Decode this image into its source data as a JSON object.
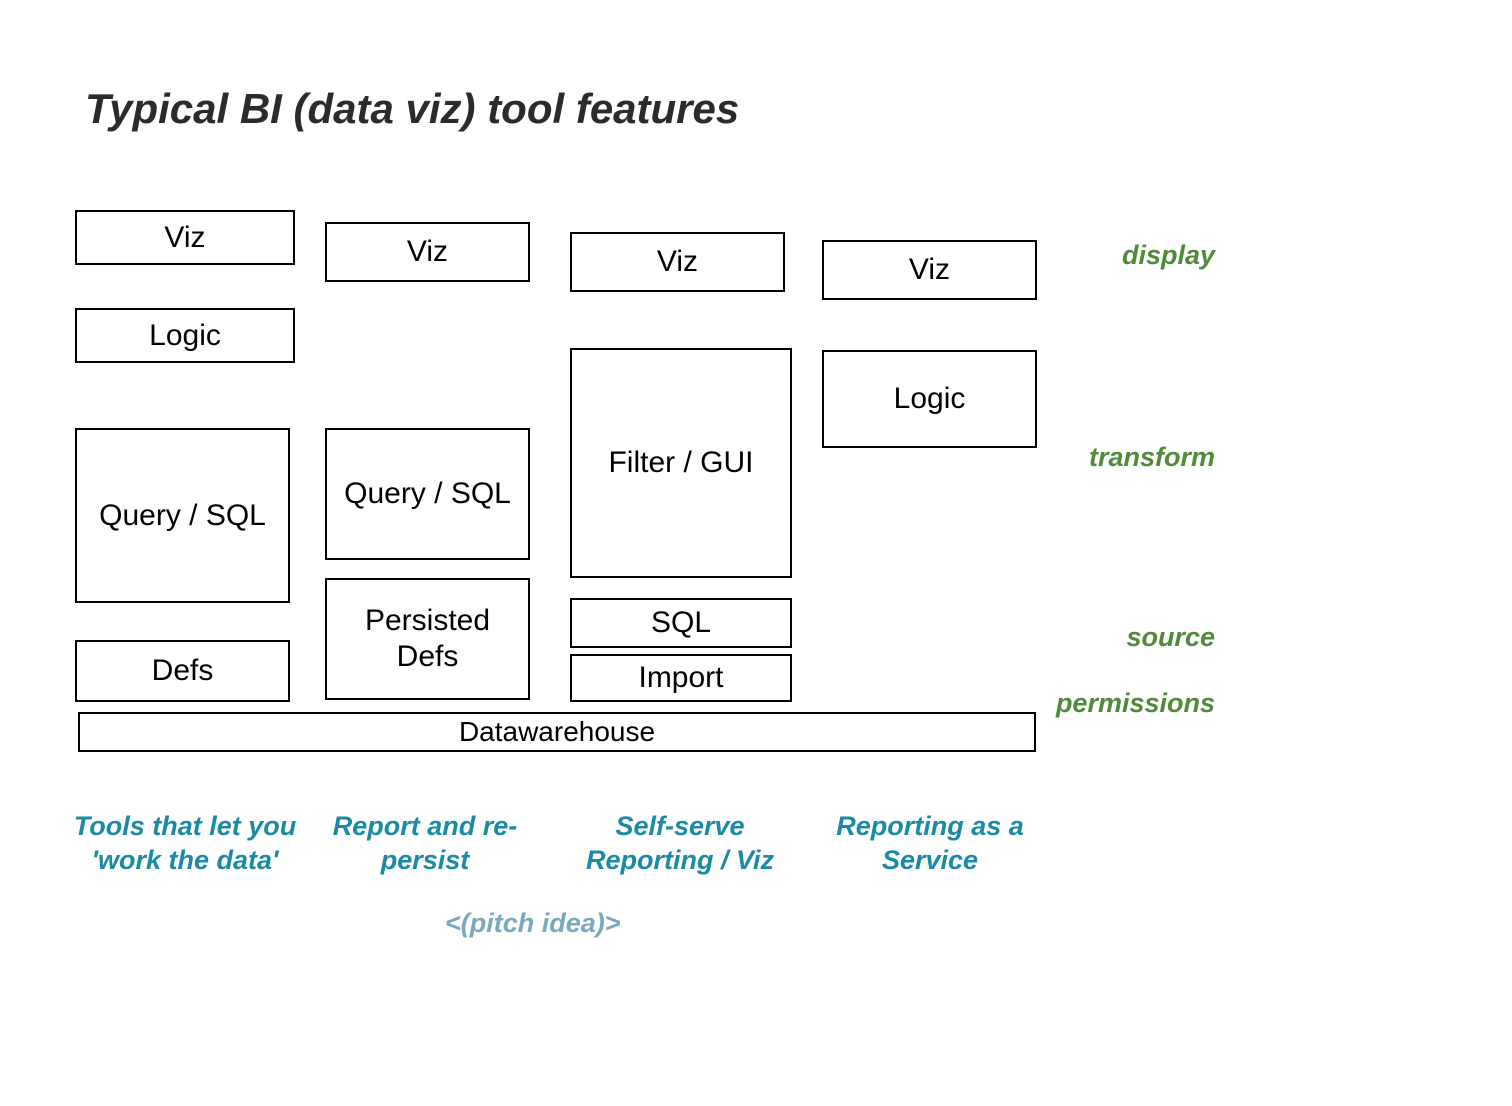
{
  "title": "Typical  BI (data viz) tool features",
  "side_labels": {
    "display": "display",
    "transform": "transform",
    "source": "source",
    "permissions": "permissions"
  },
  "columns": {
    "c1": {
      "viz": "Viz",
      "logic": "Logic",
      "query": "Query / SQL",
      "defs": "Defs",
      "label": "Tools that let you 'work the data'"
    },
    "c2": {
      "viz": "Viz",
      "query": "Query / SQL",
      "persisted": "Persisted Defs",
      "label": "Report and re-persist"
    },
    "c3": {
      "viz": "Viz",
      "filter": "Filter / GUI",
      "sql": "SQL",
      "import": "Import",
      "label": "Self-serve Reporting / Viz"
    },
    "c4": {
      "viz": "Viz",
      "logic": "Logic",
      "label": "Reporting as a Service"
    }
  },
  "datawarehouse": "Datawarehouse",
  "pitch": "<(pitch idea)>"
}
